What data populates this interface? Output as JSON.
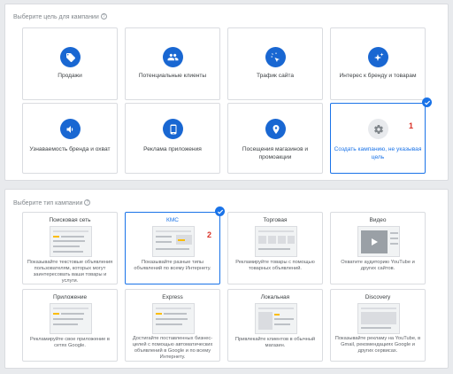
{
  "goal_section": {
    "title": "Выберите цель для кампании",
    "help": "?",
    "cards": [
      {
        "label": "Продажи",
        "icon": "tag-icon"
      },
      {
        "label": "Потенциальные клиенты",
        "icon": "people-icon"
      },
      {
        "label": "Трафик сайта",
        "icon": "cursor-click-icon"
      },
      {
        "label": "Интерес к бренду и товарам",
        "icon": "sparkle-icon"
      },
      {
        "label": "Узнаваемость бренда и охват",
        "icon": "megaphone-icon"
      },
      {
        "label": "Реклама приложения",
        "icon": "phone-icon"
      },
      {
        "label": "Посещения магазинов и промоакции",
        "icon": "location-pin-icon"
      },
      {
        "label": "Создать кампанию, не указывая цель",
        "icon": "gear-icon",
        "selected": true
      }
    ],
    "badge": "1"
  },
  "type_section": {
    "title": "Выберите тип кампании",
    "help": "?",
    "cards": [
      {
        "title": "Поисковая сеть",
        "desc": "Показывайте текстовые объявления пользователям, которых могут заинтересовать ваши товары и услуги."
      },
      {
        "title": "КМС",
        "desc": "Показывайте разные типы объявлений по всему Интернету.",
        "selected": true
      },
      {
        "title": "Торговая",
        "desc": "Рекламируйте товары с помощью товарных объявлений."
      },
      {
        "title": "Видео",
        "desc": "Охватите аудиторию YouTube и других сайтов."
      },
      {
        "title": "Приложение",
        "desc": "Рекламируйте свое приложение в сетях Google."
      },
      {
        "title": "Express",
        "desc": "Достигайте поставленных бизнес-целей с помощью автоматических объявлений в Google и по всему Интернету."
      },
      {
        "title": "Локальная",
        "desc": "Привлекайте клиентов в обычный магазин."
      },
      {
        "title": "Discovery",
        "desc": "Показывайте рекламу на YouTube, в Gmail, рекомендациях Google и других сервисах."
      }
    ],
    "badge": "2"
  },
  "colors": {
    "accent": "#1a73e8",
    "icon_bg": "#1967d2",
    "badge": "#d93025"
  }
}
